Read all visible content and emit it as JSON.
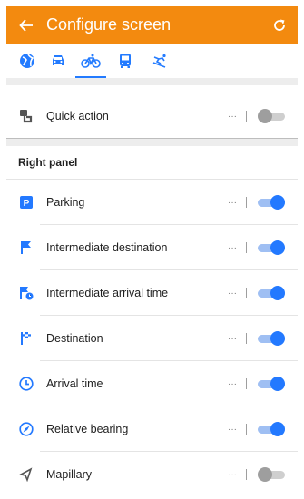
{
  "appbar": {
    "title": "Configure screen",
    "back_icon": "arrow-left-icon",
    "reset_icon": "reset-icon",
    "color": "#f38a0f"
  },
  "profiles": [
    {
      "name": "globe-icon",
      "active": false
    },
    {
      "name": "car-icon",
      "active": false
    },
    {
      "name": "bicycle-icon",
      "active": true
    },
    {
      "name": "bus-icon",
      "active": false
    },
    {
      "name": "skiing-icon",
      "active": false
    }
  ],
  "quick_action": {
    "label": "Quick action",
    "more": "···",
    "enabled": false
  },
  "right_panel": {
    "title": "Right panel",
    "items": [
      {
        "label": "Parking",
        "icon": "parking-icon",
        "more": "···",
        "enabled": true
      },
      {
        "label": "Intermediate destination",
        "icon": "flag-icon",
        "more": "···",
        "enabled": true
      },
      {
        "label": "Intermediate arrival time",
        "icon": "flag-clock-icon",
        "more": "···",
        "enabled": true
      },
      {
        "label": "Destination",
        "icon": "checkered-flag-icon",
        "more": "···",
        "enabled": true
      },
      {
        "label": "Arrival time",
        "icon": "clock-icon",
        "more": "···",
        "enabled": true
      },
      {
        "label": "Relative bearing",
        "icon": "compass-icon",
        "more": "···",
        "enabled": true
      },
      {
        "label": "Mapillary",
        "icon": "mapillary-icon",
        "more": "···",
        "enabled": false
      }
    ]
  },
  "accent_color": "#2379ff"
}
